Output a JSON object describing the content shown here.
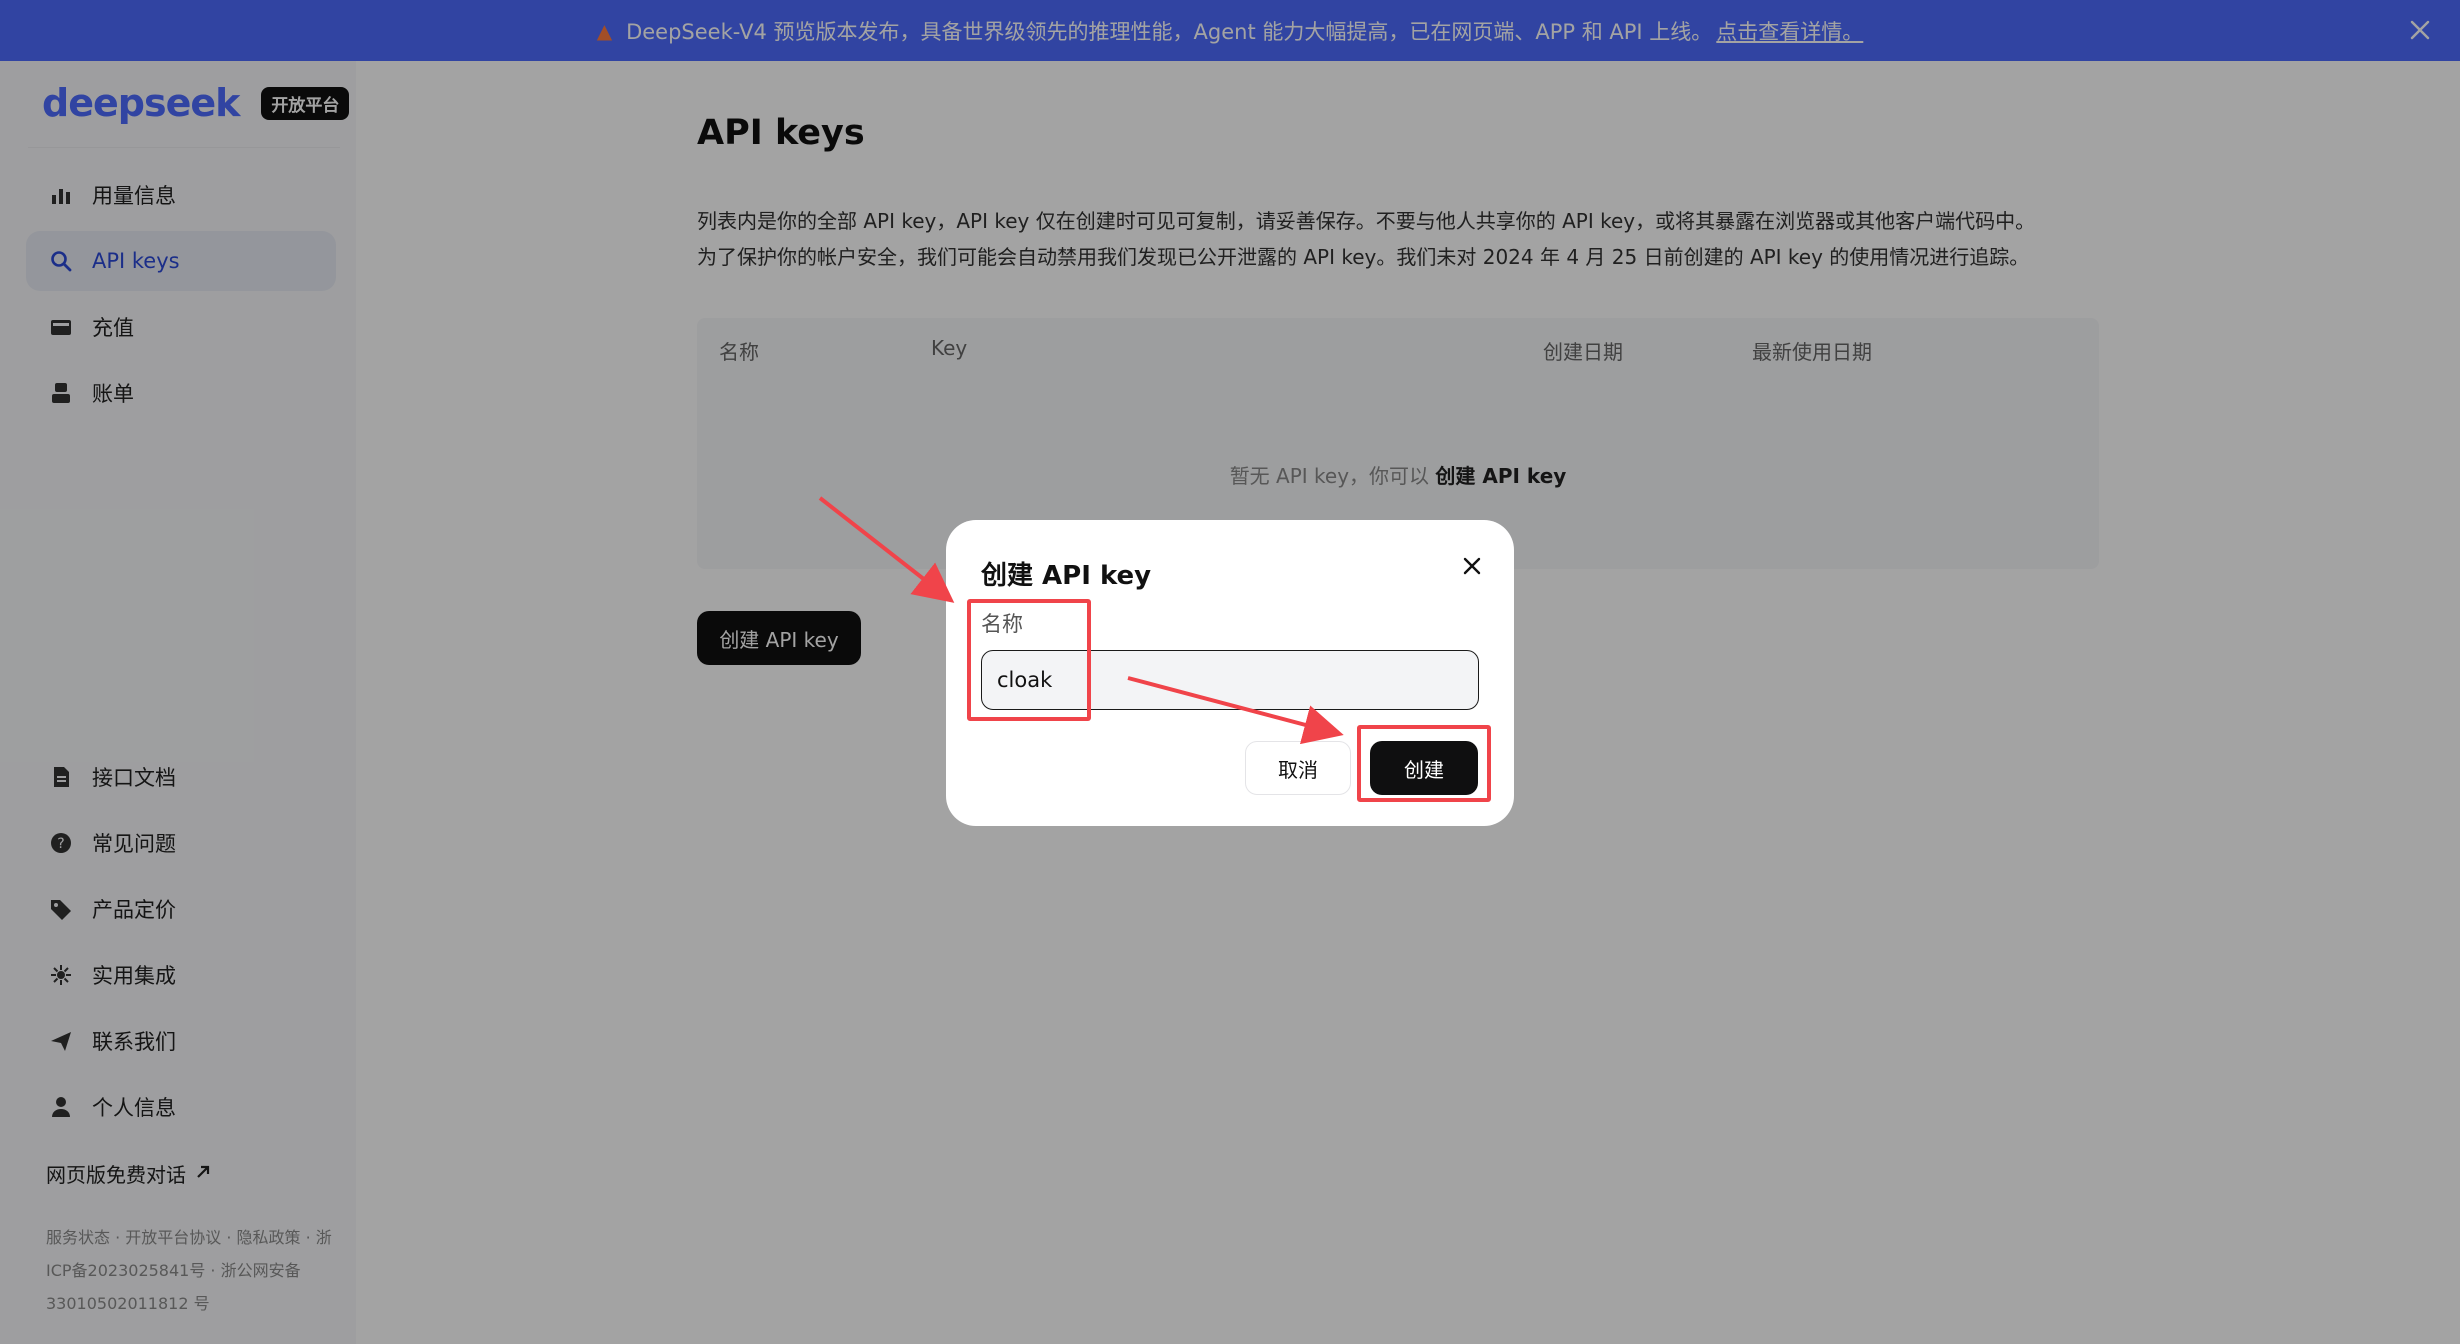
{
  "banner": {
    "text": "DeepSeek-V4 预览版本发布，具备世界级领先的推理性能，Agent 能力大幅提高，已在网页端、APP 和 API 上线。",
    "link": "点击查看详情。"
  },
  "sidebar": {
    "logo": "deepseek",
    "badge": "开放平台",
    "top_items": [
      {
        "label": "用量信息",
        "icon": "bar-chart-icon"
      },
      {
        "label": "API keys",
        "icon": "search-key-icon"
      },
      {
        "label": "充值",
        "icon": "wallet-icon"
      },
      {
        "label": "账单",
        "icon": "bill-icon"
      }
    ],
    "bottom_items": [
      {
        "label": "接口文档",
        "icon": "doc-icon"
      },
      {
        "label": "常见问题",
        "icon": "help-icon"
      },
      {
        "label": "产品定价",
        "icon": "tag-icon"
      },
      {
        "label": "实用集成",
        "icon": "integration-icon"
      },
      {
        "label": "联系我们",
        "icon": "send-icon"
      },
      {
        "label": "个人信息",
        "icon": "user-icon"
      }
    ],
    "web_chat": "网页版免费对话",
    "footer": "服务状态 · 开放平台协议 · 隐私政策 · 浙ICP备2023025841号 · 浙公网安备 33010502011812 号"
  },
  "main": {
    "title": "API keys",
    "description_line1": "列表内是你的全部 API key，API key 仅在创建时可见可复制，请妥善保存。不要与他人共享你的 API key，或将其暴露在浏览器或其他客户端代码中。",
    "description_line2": "为了保护你的帐户安全，我们可能会自动禁用我们发现已公开泄露的 API key。我们未对 2024 年 4 月 25 日前创建的 API key 的使用情况进行追踪。",
    "table_headers": [
      "名称",
      "Key",
      "创建日期",
      "最新使用日期"
    ],
    "empty_prefix": "暂无 API key，你可以",
    "empty_link": "创建 API key",
    "create_button": "创建 API key"
  },
  "modal": {
    "title": "创建 API key",
    "field_label": "名称",
    "input_value": "cloak",
    "cancel": "取消",
    "confirm": "创建"
  },
  "colors": {
    "banner": "#4d6bfe",
    "annotation": "#f0444a",
    "button_dark": "#0f0f10"
  }
}
